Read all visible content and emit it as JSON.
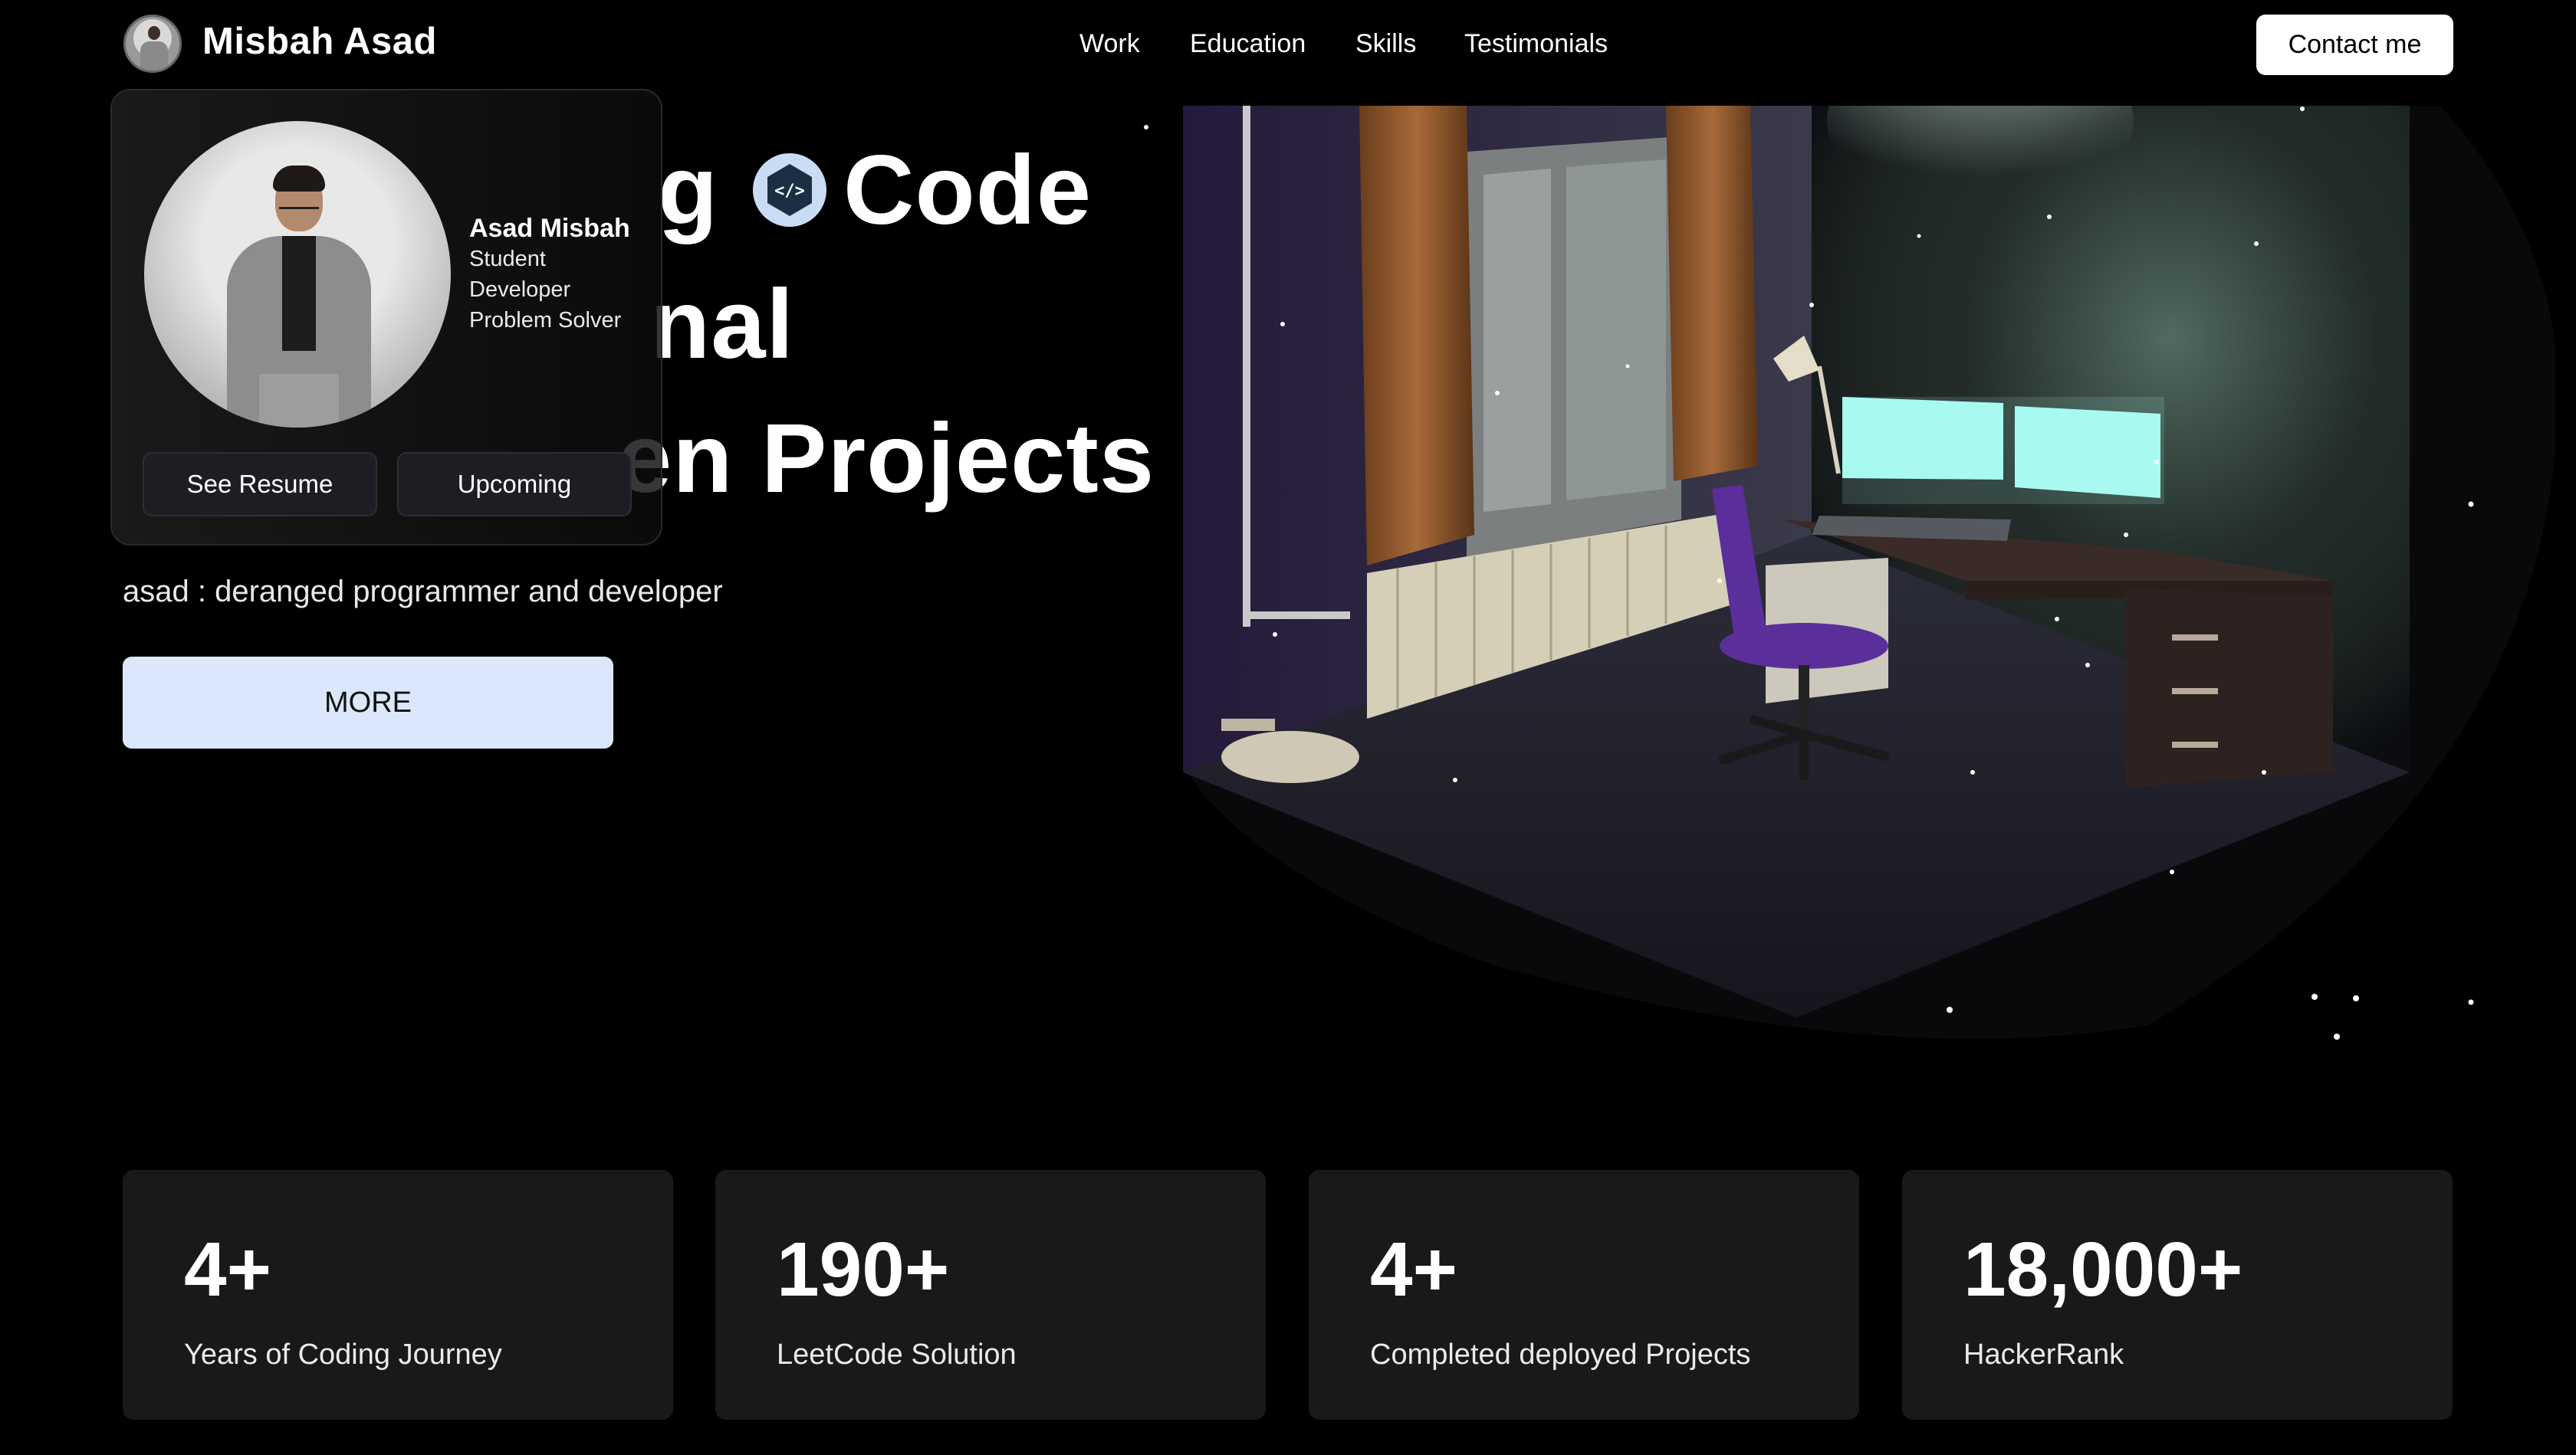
{
  "nav": {
    "brand_name": "Misbah Asad",
    "links": [
      "Work",
      "Education",
      "Skills",
      "Testimonials"
    ],
    "contact_label": "Contact me"
  },
  "hero": {
    "line1_part": "g",
    "line1_code": "Code",
    "line2": "nal",
    "line3": "en Projects",
    "tagline": "asad : deranged programmer and developer",
    "more_label": "MORE"
  },
  "profile_card": {
    "name": "Asad Misbah",
    "roles": [
      "Student",
      "Developer",
      "Problem Solver"
    ],
    "resume_label": "See Resume",
    "upcoming_label": "Upcoming"
  },
  "stats": [
    {
      "value": "4+",
      "label": "Years of Coding Journey"
    },
    {
      "value": "190+",
      "label": "LeetCode Solution"
    },
    {
      "value": "4+",
      "label": "Completed deployed Projects"
    },
    {
      "value": "18,000+",
      "label": "HackerRank"
    }
  ],
  "colors": {
    "background": "#000000",
    "card": "#19191b",
    "more_button": "#dbe8fb",
    "code_badge": "#c9dcf3",
    "monitor_glow": "#a8fbf1",
    "chair": "#5b2f9a"
  },
  "icons": {
    "code_badge": "code-icon"
  }
}
